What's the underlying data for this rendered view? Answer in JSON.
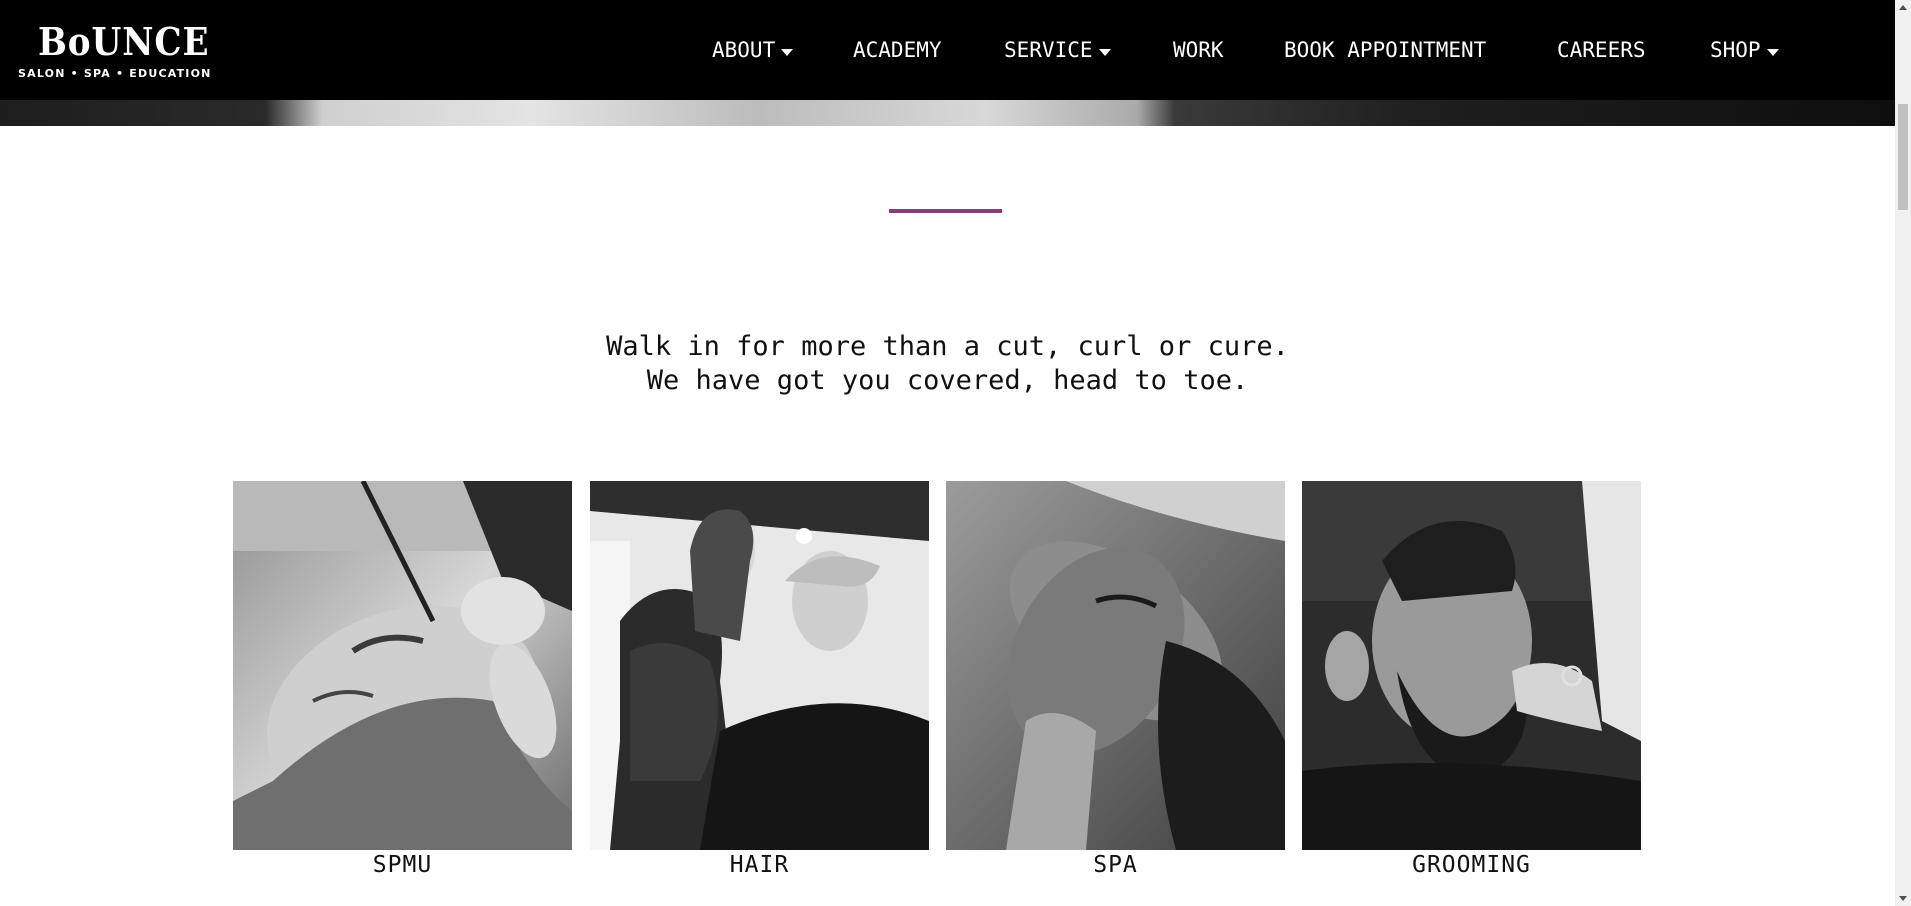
{
  "brand": {
    "name": "BoUNCE",
    "tagline": "SALON • SPA • EDUCATION"
  },
  "nav": {
    "items": [
      {
        "label": "ABOUT",
        "has_dropdown": true
      },
      {
        "label": "ACADEMY",
        "has_dropdown": false
      },
      {
        "label": "SERVICE",
        "has_dropdown": true
      },
      {
        "label": "WORK",
        "has_dropdown": false
      },
      {
        "label": "BOOK APPOINTMENT",
        "has_dropdown": false
      },
      {
        "label": "CAREERS",
        "has_dropdown": false
      },
      {
        "label": "SHOP",
        "has_dropdown": true
      }
    ]
  },
  "intro": {
    "line1": "Walk in for more than a cut, curl or cure.",
    "line2": "We have got you covered, head to toe."
  },
  "services": [
    {
      "label": "SPMU",
      "icon": "eyebrow-microblading-photo"
    },
    {
      "label": "HAIR",
      "icon": "haircut-photo"
    },
    {
      "label": "SPA",
      "icon": "facial-massage-photo"
    },
    {
      "label": "GROOMING",
      "icon": "beard-trim-photo"
    }
  ],
  "colors": {
    "header_bg": "#000000",
    "accent_divider": "#8a3d7d",
    "page_bg": "#ffffff",
    "text": "#111111"
  }
}
